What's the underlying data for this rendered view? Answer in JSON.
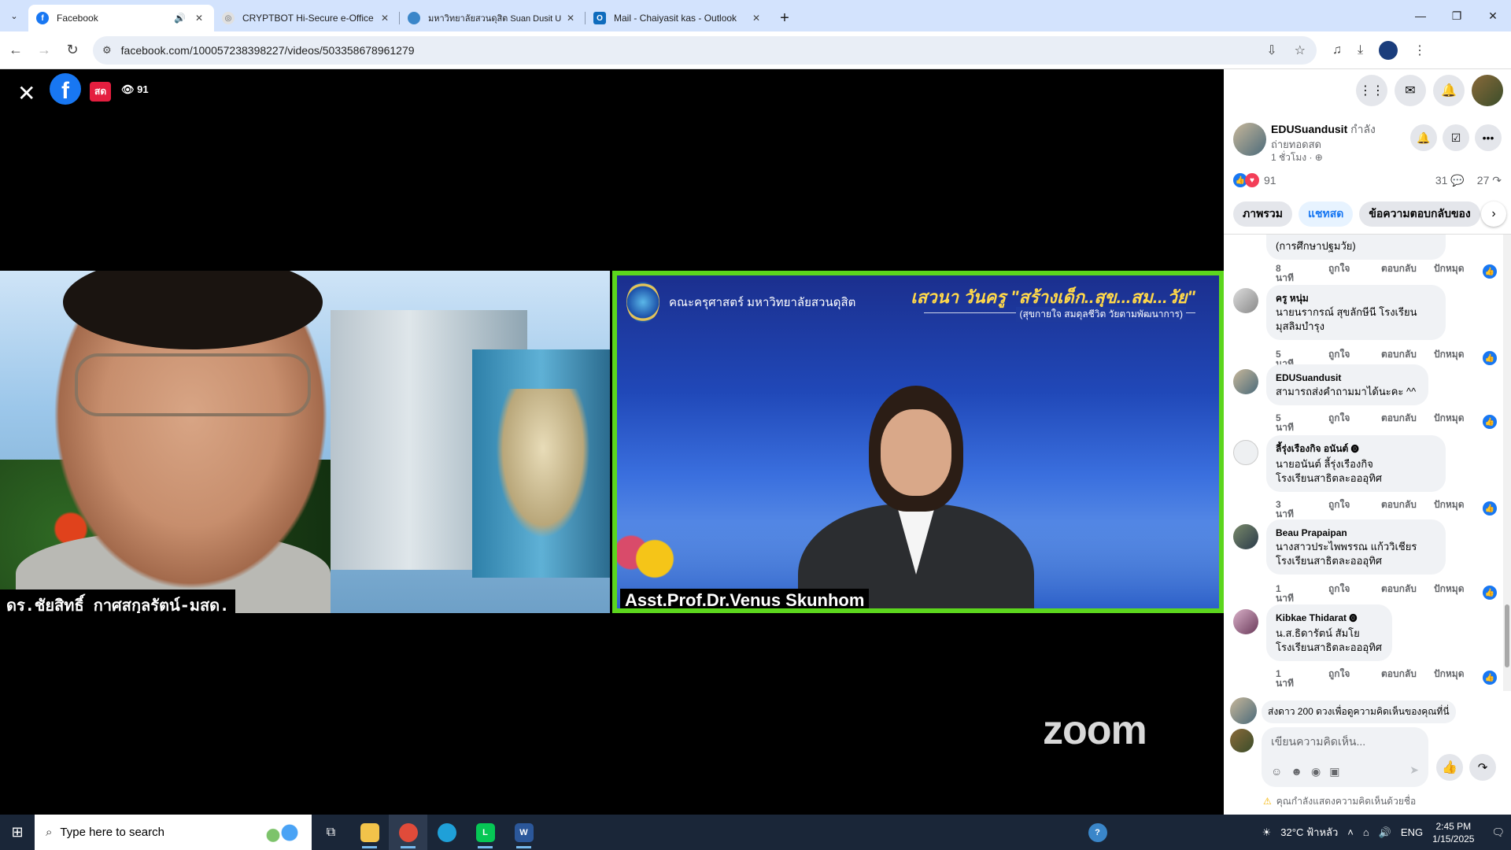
{
  "browser": {
    "tabs": [
      {
        "title": "Facebook",
        "favicon": "f",
        "favicon_color": "#1877f2",
        "audio": "🔊",
        "active": true
      },
      {
        "title": "CRYPTBOT Hi-Secure e-Office",
        "favicon": "◎",
        "favicon_color": "#5f6368"
      },
      {
        "title": "มหาวิทยาลัยสวนดุสิต Suan Dusit U",
        "favicon": "●",
        "favicon_color": "#3a86c9"
      },
      {
        "title": "Mail - Chaiyasit kas - Outlook",
        "favicon": "O",
        "favicon_color": "#0f6cbd"
      }
    ],
    "new_tab": "+",
    "url": "facebook.com/100057238398227/videos/503358678961279"
  },
  "video": {
    "live_label": "สด",
    "viewer_count": "91",
    "left_participant_name": "ดร.ชัยสิทธิ์ กาศสกุลรัตน์-มสด.",
    "faculty_text": "คณะครุศาสตร์ มหาวิทยาลัยสวนดุสิต",
    "seminar_title": "เสวนา วันครู \"สร้างเด็ก..สุข...สม...วัย\"",
    "seminar_subtitle": "(สุขกายใจ สมดุลชีวิต วัยตามพัฒนาการ)",
    "right_participant_name": "Asst.Prof.Dr.Venus Skunhom",
    "watermark": "zoom"
  },
  "post": {
    "page_name": "EDUSuandusit",
    "status_suffix": "กำลัง",
    "status_line2": "ถ่ายทอดสด",
    "time": "1 ชั่วโมง · ⊕",
    "reaction_count": "91",
    "comment_count": "31 💬",
    "share_count": "27 ↷"
  },
  "chat_tabs": [
    "ภาพรวม",
    "แชทสด",
    "ข้อความตอบกลับของ"
  ],
  "comment_actions": {
    "time_unit": "นาที",
    "like": "ถูกใจ",
    "reply": "ตอบกลับ",
    "pin": "ปักหมุด"
  },
  "comments": [
    {
      "name": "",
      "text": "(การศึกษาปฐมวัย)",
      "minutes": "8"
    },
    {
      "name": "ครู หนุ่ม",
      "text": "นายนรากรณ์ สุขลักษีนี โรงเรียนมุสลิมบำรุง",
      "minutes": "5"
    },
    {
      "name": "EDUSuandusit",
      "text": "สามารถส่งคำถามมาได้นะคะ ^^",
      "minutes": "5"
    },
    {
      "name": "ลี้รุ่งเรืองกิจ อนันต์",
      "text": "นายอนันต์ ลี้รุ่งเรืองกิจ โรงเรียนสาธิตละอออุทิศ",
      "minutes": "3"
    },
    {
      "name": "Beau Prapaipan",
      "text": "นางสาวประไพพรรณ แก้ววิเชียร โรงเรียนสาธิตละอออุทิศ",
      "minutes": "1"
    },
    {
      "name": "Kibkae Thidarat",
      "text": "น.ส.ธิดารัตน์ สัมโย โรงเรียนสาธิตละอออุทิศ",
      "minutes": "1"
    }
  ],
  "stars_prompt": "ส่งดาว 200 ดวงเพื่อดูความคิดเห็นของคุณที่นี่",
  "compose": {
    "placeholder": "เขียนความคิดเห็น..."
  },
  "warning": "คุณกำลังแสดงความคิดเห็นด้วยชื่อ",
  "taskbar": {
    "search_placeholder": "Type here to search",
    "weather": "32°C ฟ้าหลัว",
    "lang": "ENG",
    "time": "2:45 PM",
    "date": "1/15/2025"
  }
}
